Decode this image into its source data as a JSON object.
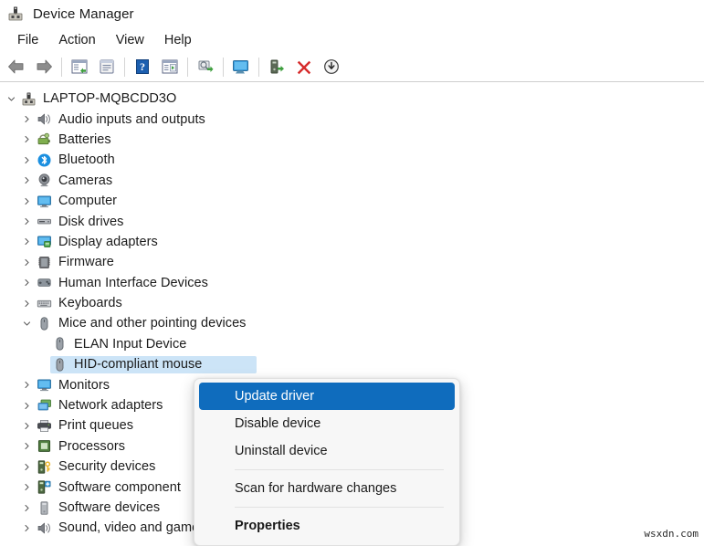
{
  "window": {
    "title": "Device Manager",
    "icon": "device-manager-icon"
  },
  "menubar": {
    "items": [
      {
        "label": "File",
        "name": "menu-file"
      },
      {
        "label": "Action",
        "name": "menu-action"
      },
      {
        "label": "View",
        "name": "menu-view"
      },
      {
        "label": "Help",
        "name": "menu-help"
      }
    ]
  },
  "toolbar": {
    "buttons": [
      {
        "icon": "back-arrow-icon",
        "name": "toolbar-back"
      },
      {
        "icon": "forward-arrow-icon",
        "name": "toolbar-forward"
      },
      {
        "separator": true
      },
      {
        "icon": "show-hide-console-tree-icon",
        "name": "toolbar-console-tree"
      },
      {
        "icon": "properties-icon",
        "name": "toolbar-properties"
      },
      {
        "separator": true
      },
      {
        "icon": "help-icon",
        "name": "toolbar-help"
      },
      {
        "icon": "show-hide-action-pane-icon",
        "name": "toolbar-action-pane"
      },
      {
        "separator": true
      },
      {
        "icon": "scan-hardware-changes-icon",
        "name": "toolbar-scan-hardware"
      },
      {
        "separator": true
      },
      {
        "icon": "display-icon",
        "name": "toolbar-display"
      },
      {
        "separator": true
      },
      {
        "icon": "update-driver-icon",
        "name": "toolbar-update-driver"
      },
      {
        "icon": "uninstall-device-icon",
        "name": "toolbar-uninstall-device"
      },
      {
        "icon": "disable-device-icon",
        "name": "toolbar-disable-device"
      }
    ]
  },
  "tree": {
    "nodes": [
      {
        "label": "LAPTOP-MQBCDD3O",
        "level": 0,
        "twisty": "expanded",
        "icon": "computer-node-icon",
        "selected": false
      },
      {
        "label": "Audio inputs and outputs",
        "level": 1,
        "twisty": "collapsed",
        "icon": "speaker-icon",
        "selected": false
      },
      {
        "label": "Batteries",
        "level": 1,
        "twisty": "collapsed",
        "icon": "battery-icon",
        "selected": false
      },
      {
        "label": "Bluetooth",
        "level": 1,
        "twisty": "collapsed",
        "icon": "bluetooth-icon",
        "selected": false
      },
      {
        "label": "Cameras",
        "level": 1,
        "twisty": "collapsed",
        "icon": "camera-icon",
        "selected": false
      },
      {
        "label": "Computer",
        "level": 1,
        "twisty": "collapsed",
        "icon": "monitor-icon",
        "selected": false
      },
      {
        "label": "Disk drives",
        "level": 1,
        "twisty": "collapsed",
        "icon": "disk-drive-icon",
        "selected": false
      },
      {
        "label": "Display adapters",
        "level": 1,
        "twisty": "collapsed",
        "icon": "display-adapter-icon",
        "selected": false
      },
      {
        "label": "Firmware",
        "level": 1,
        "twisty": "collapsed",
        "icon": "firmware-icon",
        "selected": false
      },
      {
        "label": "Human Interface Devices",
        "level": 1,
        "twisty": "collapsed",
        "icon": "hid-icon",
        "selected": false
      },
      {
        "label": "Keyboards",
        "level": 1,
        "twisty": "collapsed",
        "icon": "keyboard-icon",
        "selected": false
      },
      {
        "label": "Mice and other pointing devices",
        "level": 1,
        "twisty": "expanded",
        "icon": "mouse-icon",
        "selected": false
      },
      {
        "label": "ELAN Input Device",
        "level": 2,
        "twisty": "none",
        "icon": "mouse-icon",
        "selected": false
      },
      {
        "label": "HID-compliant mouse",
        "level": 2,
        "twisty": "none",
        "icon": "mouse-icon",
        "selected": true
      },
      {
        "label": "Monitors",
        "level": 1,
        "twisty": "collapsed",
        "icon": "monitor-icon",
        "selected": false
      },
      {
        "label": "Network adapters",
        "level": 1,
        "twisty": "collapsed",
        "icon": "network-adapter-icon",
        "selected": false
      },
      {
        "label": "Print queues",
        "level": 1,
        "twisty": "collapsed",
        "icon": "printer-icon",
        "selected": false
      },
      {
        "label": "Processors",
        "level": 1,
        "twisty": "collapsed",
        "icon": "processor-icon",
        "selected": false
      },
      {
        "label": "Security devices",
        "level": 1,
        "twisty": "collapsed",
        "icon": "security-device-icon",
        "selected": false
      },
      {
        "label": "Software component",
        "level": 1,
        "twisty": "collapsed",
        "icon": "software-component-icon",
        "selected": false
      },
      {
        "label": "Software devices",
        "level": 1,
        "twisty": "collapsed",
        "icon": "software-device-icon",
        "selected": false
      },
      {
        "label": "Sound, video and game controllers",
        "level": 1,
        "twisty": "collapsed",
        "icon": "speaker-icon",
        "selected": false
      }
    ]
  },
  "context_menu": {
    "items": [
      {
        "label": "Update driver",
        "name": "context-menu-update-driver",
        "highlighted": true,
        "bold": false
      },
      {
        "label": "Disable device",
        "name": "context-menu-disable-device",
        "highlighted": false,
        "bold": false
      },
      {
        "label": "Uninstall device",
        "name": "context-menu-uninstall-device",
        "highlighted": false,
        "bold": false
      },
      {
        "separator": true
      },
      {
        "label": "Scan for hardware changes",
        "name": "context-menu-scan-hardware",
        "highlighted": false,
        "bold": false
      },
      {
        "separator": true
      },
      {
        "label": "Properties",
        "name": "context-menu-properties",
        "highlighted": false,
        "bold": true
      }
    ]
  },
  "watermark": {
    "text": "wsxdn.com"
  },
  "colors": {
    "selection_blue": "#0f6cbd",
    "tree_selection": "#cce4f7",
    "menu_background": "#f7f7f7",
    "window_background": "#ffffff"
  }
}
